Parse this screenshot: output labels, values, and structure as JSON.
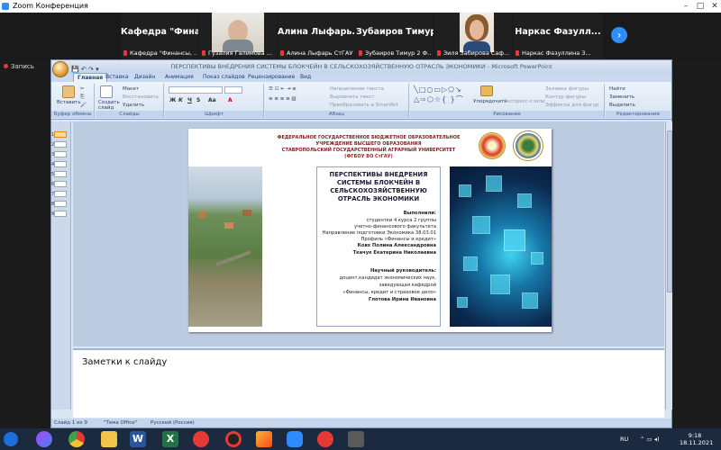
{
  "zoom": {
    "title": "Zoom Конференция",
    "recording": "Запись",
    "participants": [
      {
        "big": "Кафедра \"Фина...",
        "small": "Кафедра \"Финансы, ..."
      },
      {
        "big": "",
        "small": "Гузалия Галимова ..."
      },
      {
        "big": "Алина Лыфарь...",
        "small": "Алина Лыфарь СтГАУ"
      },
      {
        "big": "Зубаиров Тимур...",
        "small": "Зубаиров Тимур 2 Ф..."
      },
      {
        "big": "",
        "small": "Зиля Забирова Саф..."
      },
      {
        "big": "Наркас Фазулл...",
        "small": "Наркас Фазуллина З..."
      }
    ]
  },
  "powerpoint": {
    "window_title": "ПЕРСПЕКТИВЫ ВНЕДРЕНИЯ СИСТЕМЫ БЛОКЧЕЙН В СЕЛЬСКОХОЗЯЙСТВЕННУЮ ОТРАСЛЬ ЭКОНОМИКИ - Microsoft PowerPoint",
    "tabs": [
      "Главная",
      "Вставка",
      "Дизайн",
      "Анимация",
      "Показ слайдов",
      "Рецензирование",
      "Вид"
    ],
    "ribbon": {
      "clipboard": {
        "paste": "Вставить",
        "label": "Буфер обмена"
      },
      "slides": {
        "new_slide": "Создать слайд",
        "layout": "Макет",
        "reset": "Восстановить",
        "delete": "Удалить",
        "label": "Слайды"
      },
      "font": {
        "label": "Шрифт"
      },
      "paragraph": {
        "text_direction": "Направление текста",
        "align_text": "Выровнять текст",
        "smartart": "Преобразовать в SmartArt",
        "label": "Абзац"
      },
      "drawing": {
        "arrange": "Упорядочить",
        "quick_styles": "Экспресс-стили",
        "shape_fill": "Заливка фигуры",
        "shape_outline": "Контур фигуры",
        "shape_effects": "Эффекты для фигур",
        "label": "Рисование"
      },
      "editing": {
        "find": "Найти",
        "replace": "Заменить",
        "select": "Выделить",
        "label": "Редактирование"
      }
    },
    "slide_numbers": [
      "1",
      "2",
      "3",
      "4",
      "5",
      "6",
      "7",
      "8",
      "9"
    ],
    "notes_placeholder": "Заметки к слайду",
    "status": {
      "slide": "Слайд 1 из 9",
      "theme": "\"Тема Office\"",
      "language": "Русский (Россия)"
    }
  },
  "slide": {
    "institution": [
      "ФЕДЕРАЛЬНОЕ ГОСУДАРСТВЕННОЕ БЮДЖЕТНОЕ ОБРАЗОВАТЕЛЬНОЕ",
      "УЧРЕЖДЕНИЕ ВЫСШЕГО ОБРАЗОВАНИЯ",
      "СТАВРОПОЛЬСКИЙ ГОСУДАРСТВЕННЫЙ АГРАРНЫЙ УНИВЕРСИТЕТ"
    ],
    "institution_abbr": "(ФГБОУ ВО СтГАУ)",
    "title": "ПЕРСПЕКТИВЫ ВНЕДРЕНИЯ СИСТЕМЫ БЛОКЧЕЙН В СЕЛЬСКОХОЗЯЙСТВЕННУЮ ОТРАСЛЬ ЭКОНОМИКИ",
    "performed_label": "Выполнили:",
    "performed_lines": [
      "студентки 4 курса 2 группы",
      "учетно-финансового факультета",
      "Направление подготовки Экономика 38.03.01",
      "Профиль «Финансы и кредит»"
    ],
    "students": [
      "Ковх Полина Александровна",
      "Ткачук Екатерина Николаевна"
    ],
    "supervisor_label": "Научный руководитель:",
    "supervisor_lines": [
      "доцент,кандидат экономических наук,",
      "заведующая кафедрой",
      "«Финансы, кредит и страховое дело»"
    ],
    "supervisor_name": "Глотова Ирина Ивановна"
  },
  "taskbar": {
    "lang": "RU",
    "time": "9:18",
    "date": "18.11.2021"
  }
}
